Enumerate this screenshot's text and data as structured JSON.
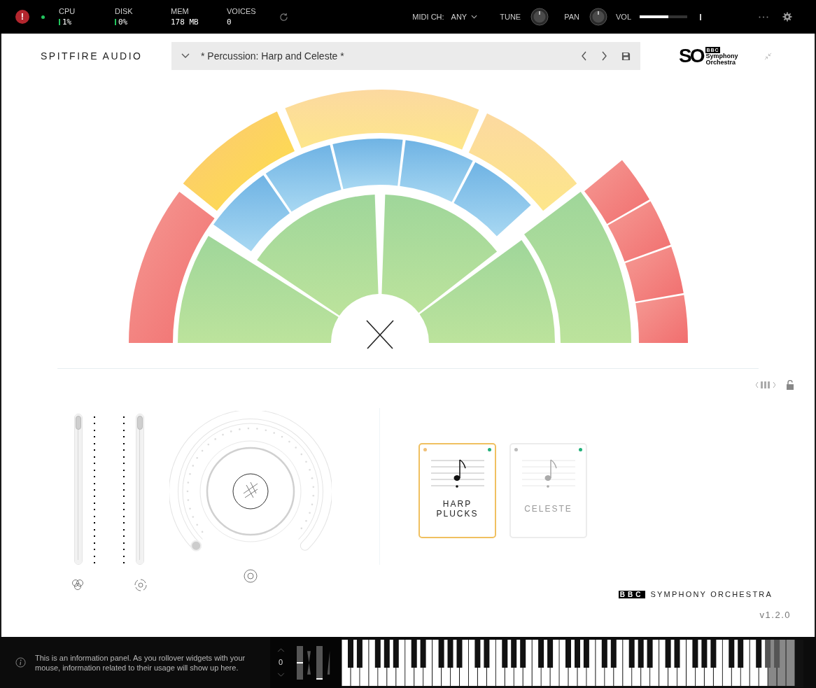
{
  "top_bar": {
    "alert": "!",
    "stats": [
      {
        "label": "CPU",
        "value": "1%",
        "meter": true
      },
      {
        "label": "DISK",
        "value": "0%",
        "meter": true
      },
      {
        "label": "MEM",
        "value": "178 MB",
        "meter": false
      },
      {
        "label": "VOICES",
        "value": "0",
        "meter": false
      }
    ],
    "midi_channel": {
      "label": "MIDI CH:",
      "value": "ANY"
    },
    "knobs": [
      {
        "label": "TUNE"
      },
      {
        "label": "PAN"
      }
    ],
    "volume": {
      "label": "VOL",
      "level": 0.6
    }
  },
  "header": {
    "brand": "SPITFIRE AUDIO",
    "preset": "* Percussion: Harp and Celeste *",
    "logo": {
      "mark": "SO",
      "bbc": "BBC",
      "lines": [
        "Symphony",
        "Orchestra"
      ]
    }
  },
  "faders": [
    {
      "level": 1.0
    },
    {
      "level": 1.0
    }
  ],
  "dial": {
    "level": 0.0
  },
  "articulations": [
    {
      "label": "HARP PLUCKS",
      "selected": true
    },
    {
      "label": "CELESTE",
      "selected": false
    }
  ],
  "footer_brand": {
    "bbc": "BBC",
    "name": "SYMPHONY ORCHESTRA",
    "version": "v1.2.0"
  },
  "info_panel": {
    "text": "This is an information panel. As you rollover widgets with your mouse, information related to their usage will show up here.",
    "octave": "0",
    "wheels": [
      {
        "level": 0.5
      },
      {
        "level": 0.0
      }
    ]
  }
}
